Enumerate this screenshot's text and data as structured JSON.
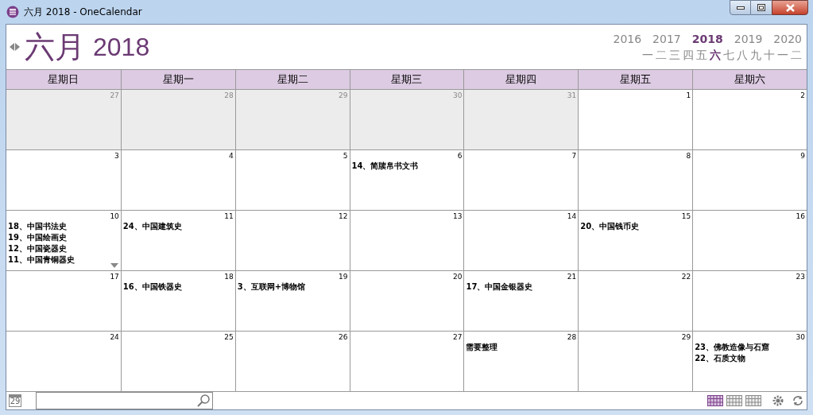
{
  "window": {
    "title": "六月 2018 - OneCalendar"
  },
  "header": {
    "month": "六月",
    "year": "2018"
  },
  "years": [
    {
      "label": "2016",
      "selected": false
    },
    {
      "label": "2017",
      "selected": false
    },
    {
      "label": "2018",
      "selected": true
    },
    {
      "label": "2019",
      "selected": false
    },
    {
      "label": "2020",
      "selected": false
    }
  ],
  "months": [
    {
      "label": "一",
      "selected": false
    },
    {
      "label": "二",
      "selected": false
    },
    {
      "label": "三",
      "selected": false
    },
    {
      "label": "四",
      "selected": false
    },
    {
      "label": "五",
      "selected": false
    },
    {
      "label": "六",
      "selected": true
    },
    {
      "label": "七",
      "selected": false
    },
    {
      "label": "八",
      "selected": false
    },
    {
      "label": "九",
      "selected": false
    },
    {
      "label": "十",
      "selected": false
    },
    {
      "label": "一",
      "selected": false
    },
    {
      "label": "二",
      "selected": false
    }
  ],
  "weekdays": [
    "星期日",
    "星期一",
    "星期二",
    "星期三",
    "星期四",
    "星期五",
    "星期六"
  ],
  "days": [
    {
      "day": "27",
      "in_month": false
    },
    {
      "day": "28",
      "in_month": false
    },
    {
      "day": "29",
      "in_month": false
    },
    {
      "day": "30",
      "in_month": false
    },
    {
      "day": "31",
      "in_month": false
    },
    {
      "day": "1",
      "in_month": true
    },
    {
      "day": "2",
      "in_month": true
    },
    {
      "day": "3",
      "in_month": true
    },
    {
      "day": "4",
      "in_month": true
    },
    {
      "day": "5",
      "in_month": true
    },
    {
      "day": "6",
      "in_month": true,
      "events": [
        "14、简牍帛书文书"
      ]
    },
    {
      "day": "7",
      "in_month": true
    },
    {
      "day": "8",
      "in_month": true
    },
    {
      "day": "9",
      "in_month": true
    },
    {
      "day": "10",
      "in_month": true,
      "events": [
        "18、中国书法史",
        "19、中国绘画史",
        "12、中国瓷器史",
        "11、中国青铜器史"
      ],
      "more": true
    },
    {
      "day": "11",
      "in_month": true,
      "events": [
        "24、中国建筑史"
      ]
    },
    {
      "day": "12",
      "in_month": true
    },
    {
      "day": "13",
      "in_month": true
    },
    {
      "day": "14",
      "in_month": true
    },
    {
      "day": "15",
      "in_month": true,
      "events": [
        "20、中国钱币史"
      ]
    },
    {
      "day": "16",
      "in_month": true
    },
    {
      "day": "17",
      "in_month": true
    },
    {
      "day": "18",
      "in_month": true,
      "events": [
        "16、中国铁器史"
      ]
    },
    {
      "day": "19",
      "in_month": true,
      "events": [
        "3、互联网+博物馆"
      ]
    },
    {
      "day": "20",
      "in_month": true
    },
    {
      "day": "21",
      "in_month": true,
      "events": [
        "17、中国金银器史"
      ]
    },
    {
      "day": "22",
      "in_month": true
    },
    {
      "day": "23",
      "in_month": true
    },
    {
      "day": "24",
      "in_month": true
    },
    {
      "day": "25",
      "in_month": true
    },
    {
      "day": "26",
      "in_month": true
    },
    {
      "day": "27",
      "in_month": true
    },
    {
      "day": "28",
      "in_month": true,
      "events": [
        "需要整理"
      ]
    },
    {
      "day": "29",
      "in_month": true
    },
    {
      "day": "30",
      "in_month": true,
      "events": [
        "23、佛教造像与石窟",
        "22、石质文物"
      ]
    }
  ],
  "footer": {
    "today": "29",
    "views": [
      {
        "selected": true
      },
      {
        "selected": false
      },
      {
        "selected": false
      }
    ]
  }
}
